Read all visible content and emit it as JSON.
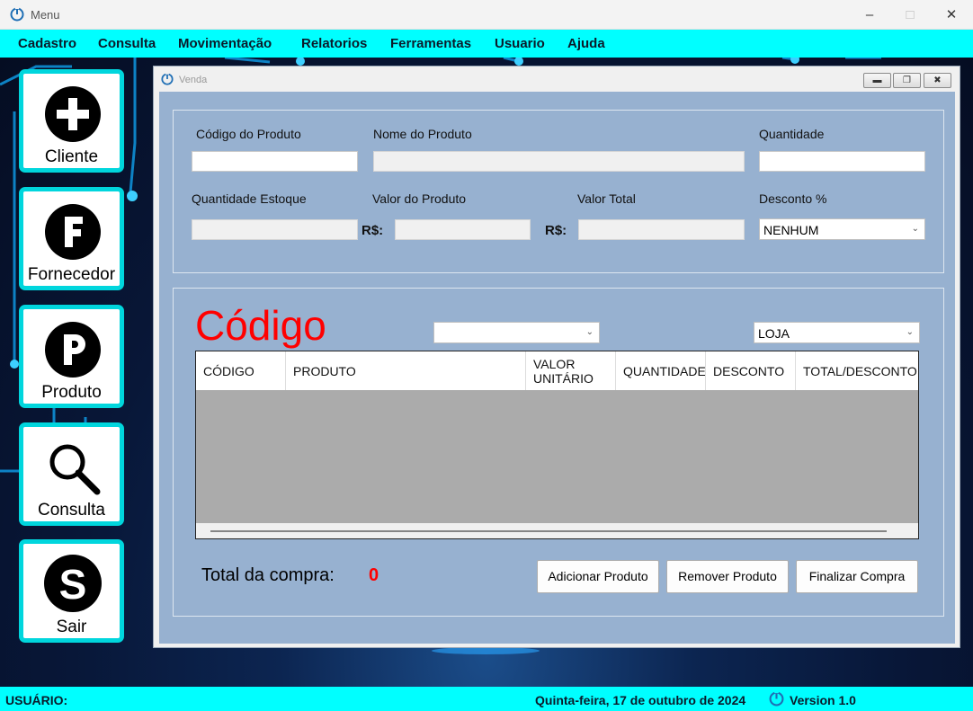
{
  "window": {
    "title": "Menu"
  },
  "menu": [
    "Cadastro",
    "Consulta",
    "Movimentação",
    "Relatorios",
    "Ferramentas",
    "Usuario",
    "Ajuda"
  ],
  "sidebar": [
    {
      "label": "Cliente",
      "icon": "plus-icon"
    },
    {
      "label": "Fornecedor",
      "icon": "letter-f-icon"
    },
    {
      "label": "Produto",
      "icon": "letter-p-icon"
    },
    {
      "label": "Consulta",
      "icon": "magnifier-icon"
    },
    {
      "label": "Sair",
      "icon": "letter-s-icon"
    }
  ],
  "venda": {
    "title": "Venda",
    "fields": {
      "codigo_label": "Código do Produto",
      "nome_label": "Nome do Produto",
      "quantidade_label": "Quantidade",
      "estoque_label": "Quantidade Estoque",
      "valor_label": "Valor do Produto",
      "valor_total_label": "Valor Total",
      "desconto_label": "Desconto %",
      "currency_1": "R$:",
      "currency_2": "R$:",
      "desconto_value": "NENHUM",
      "codigo_value": "",
      "nome_value": "",
      "quantidade_value": "",
      "estoque_value": "",
      "valor_value": "",
      "valor_total_value": ""
    },
    "section_title": "Código",
    "filter_select_value": "",
    "store_select_value": "LOJA",
    "table": {
      "columns": [
        "CÓDIGO",
        "PRODUTO",
        "VALOR UNITÁRIO",
        "QUANTIDADE",
        "DESCONTO",
        "TOTAL/DESCONTO"
      ],
      "rows": []
    },
    "total_label": "Total da  compra:",
    "total_value": "0",
    "buttons": {
      "add": "Adicionar Produto",
      "remove": "Remover Produto",
      "finish": "Finalizar Compra"
    }
  },
  "status": {
    "user_label": "USUÁRIO:",
    "date": "Quinta-feira, 17 de outubro de 2024",
    "version": "Version 1.0"
  },
  "colors": {
    "accent": "#00ffff",
    "form_bg": "#97b1d0",
    "codigo_red": "#ff0000"
  }
}
